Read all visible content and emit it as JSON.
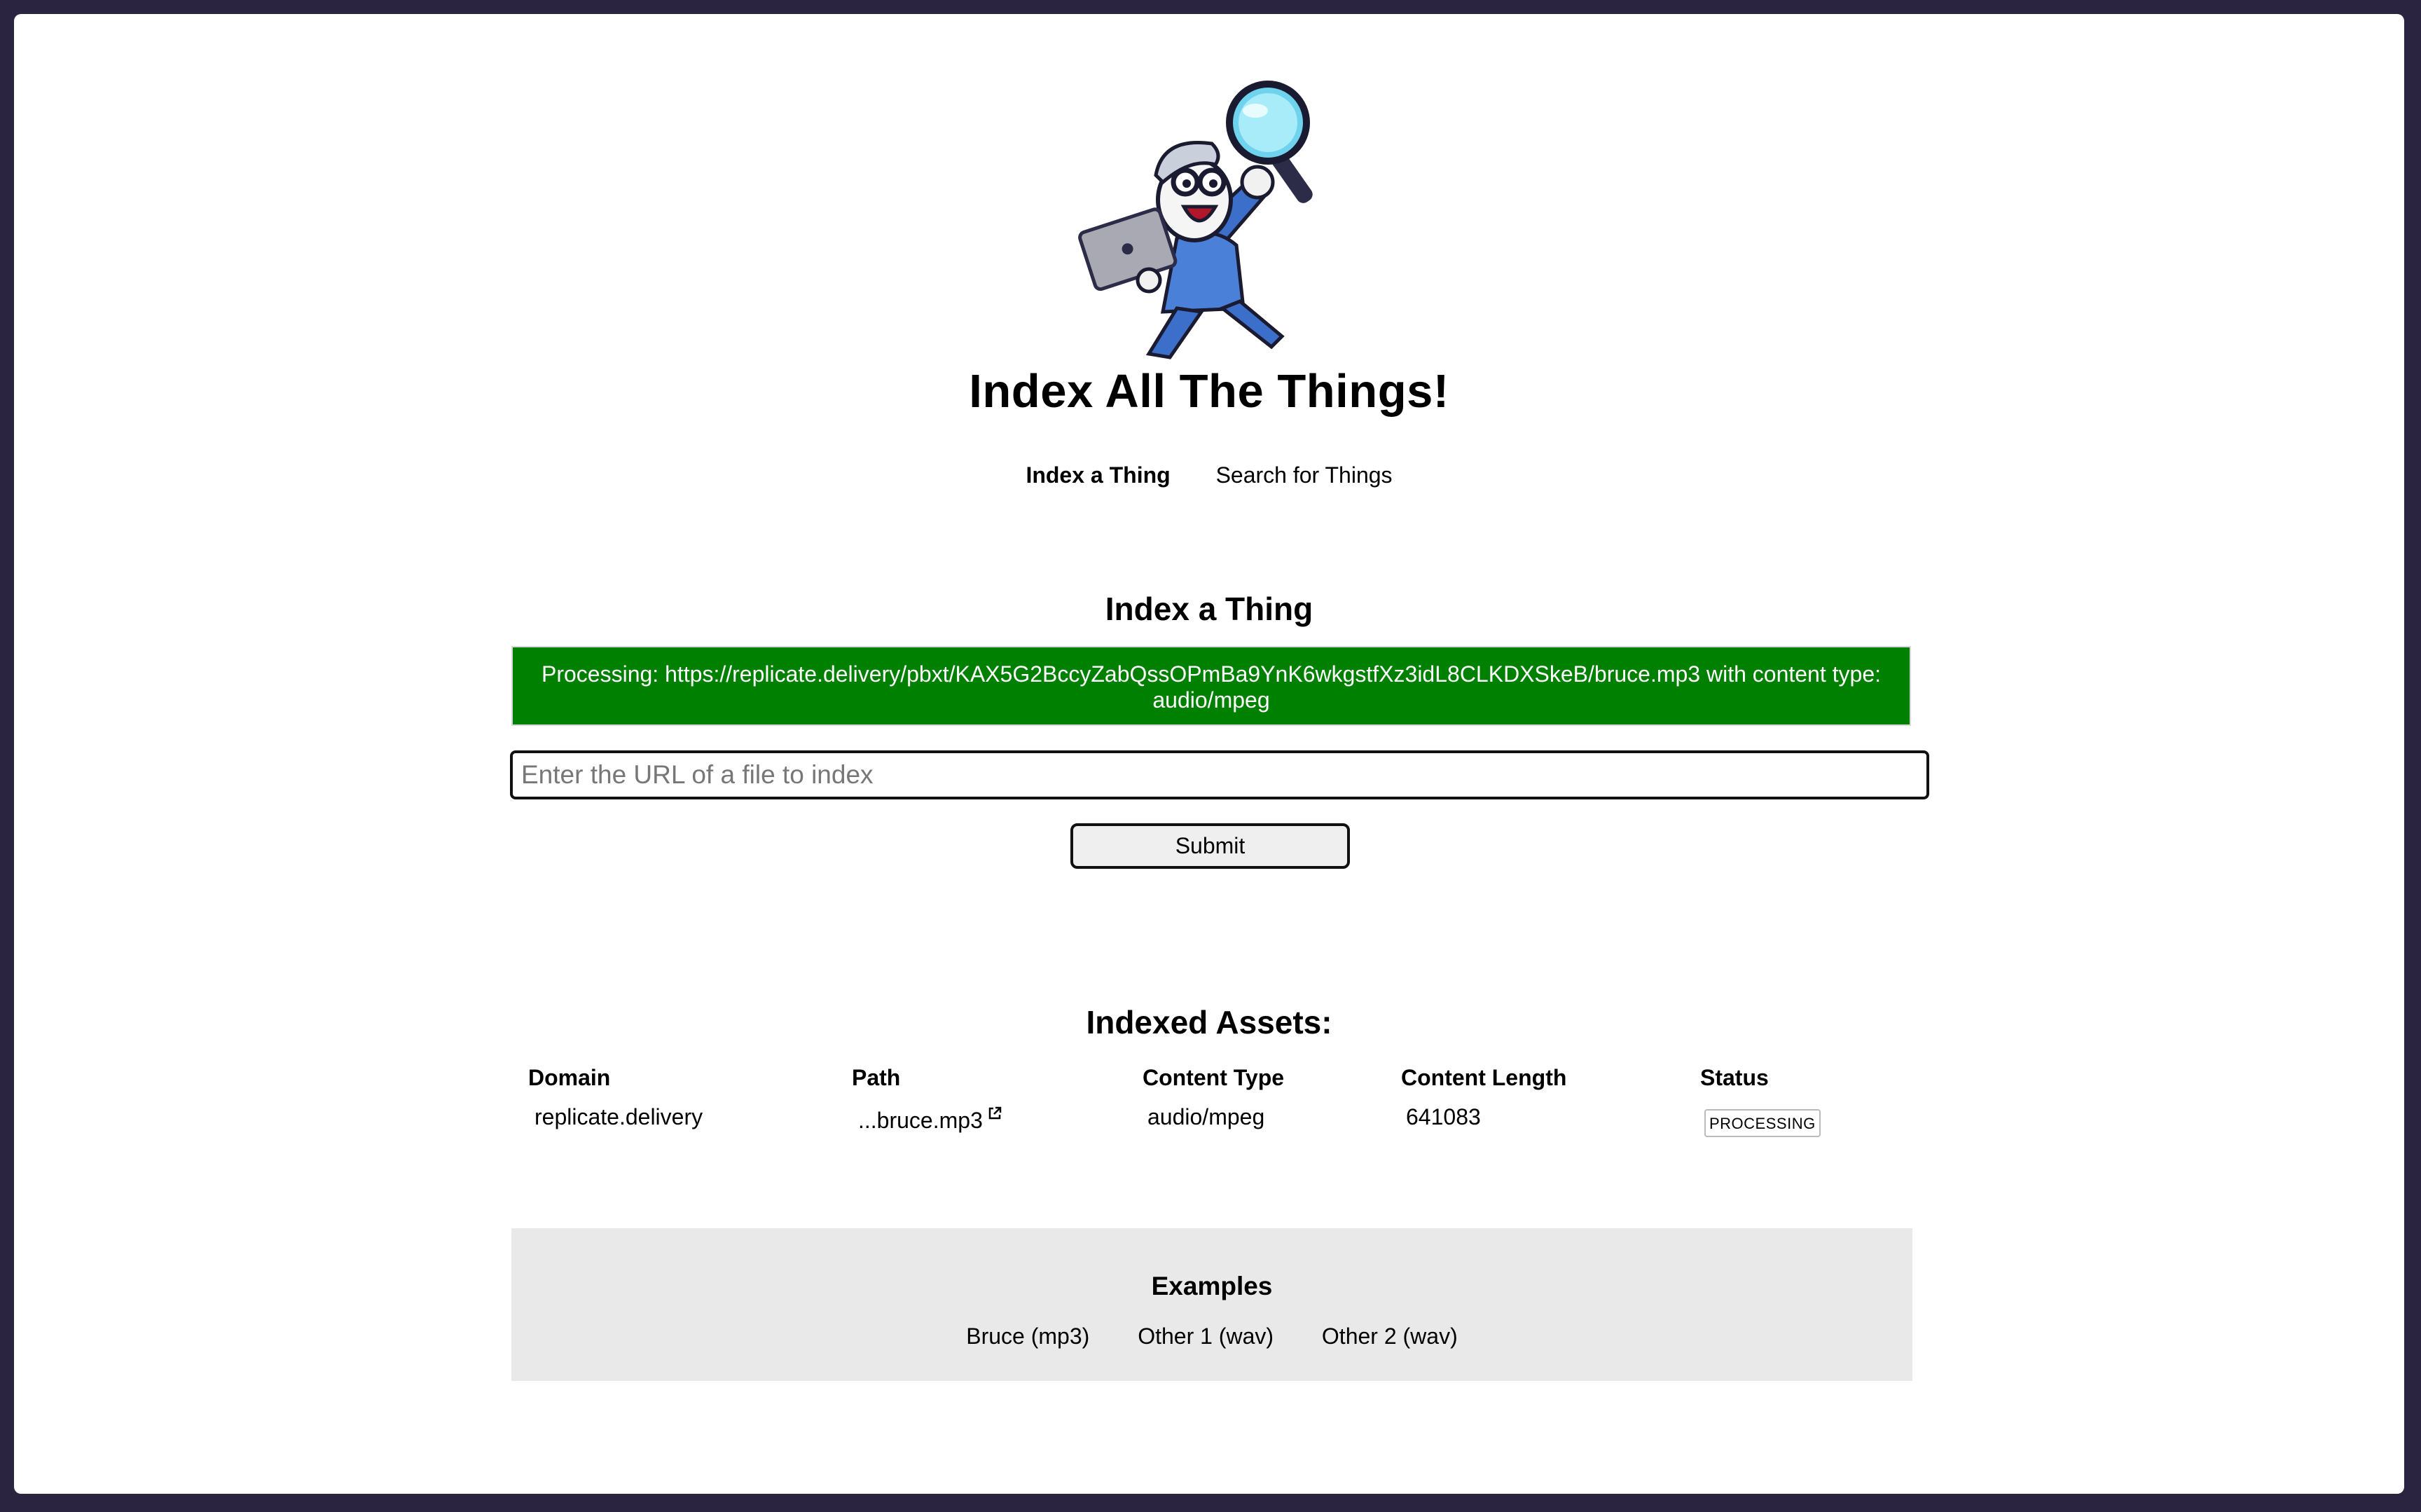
{
  "site": {
    "title": "Index All The Things!",
    "mascot_name": "mascot-illustration"
  },
  "nav": {
    "items": [
      {
        "label": "Index a Thing",
        "active": true
      },
      {
        "label": "Search for Things",
        "active": false
      }
    ]
  },
  "index_form": {
    "heading": "Index a Thing",
    "status_message": "Processing: https://replicate.delivery/pbxt/KAX5G2BccyZabQssOPmBa9YnK6wkgstfXz3idL8CLKDXSkeB/bruce.mp3 with content type: audio/mpeg",
    "status_color": "#008000",
    "url_placeholder": "Enter the URL of a file to index",
    "url_value": "",
    "submit_label": "Submit"
  },
  "assets": {
    "heading": "Indexed Assets:",
    "columns": [
      "Domain",
      "Path",
      "Content Type",
      "Content Length",
      "Status"
    ],
    "rows": [
      {
        "domain": "replicate.delivery",
        "path": "...bruce.mp3",
        "path_icon": "external-link-icon",
        "content_type": "audio/mpeg",
        "content_length": "641083",
        "status": "PROCESSING"
      }
    ]
  },
  "examples": {
    "heading": "Examples",
    "links": [
      "Bruce (mp3)",
      "Other 1 (wav)",
      "Other 2 (wav)"
    ]
  }
}
